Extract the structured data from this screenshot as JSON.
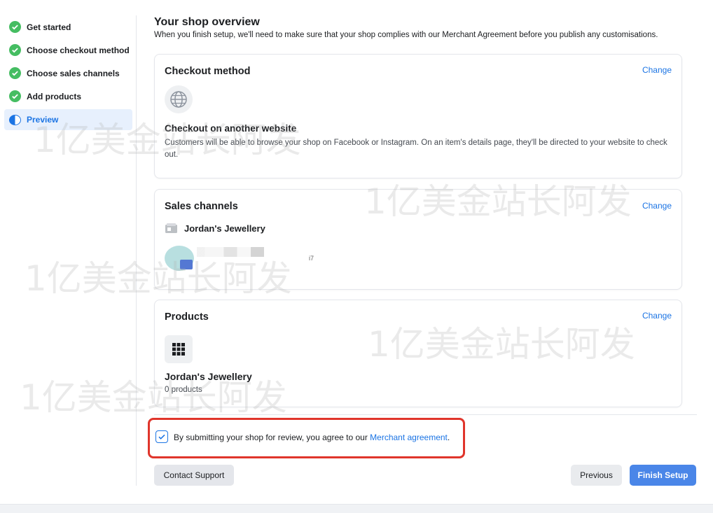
{
  "sidebar": {
    "steps": [
      {
        "label": "Get started",
        "state": "done"
      },
      {
        "label": "Choose checkout method",
        "state": "done"
      },
      {
        "label": "Choose sales channels",
        "state": "done"
      },
      {
        "label": "Add products",
        "state": "done"
      },
      {
        "label": "Preview",
        "state": "active"
      }
    ]
  },
  "header": {
    "title": "Your shop overview",
    "subtitle": "When you finish setup, we'll need to make sure that your shop complies with our Merchant Agreement before you publish any customisations."
  },
  "checkout": {
    "heading": "Checkout method",
    "change": "Change",
    "icon": "globe-icon",
    "method": "Checkout on another website",
    "description": "Customers will be able to browse your shop on Facebook or Instagram. On an item's details page, they'll be directed to your website to check out."
  },
  "sales": {
    "heading": "Sales channels",
    "change": "Change",
    "channel_name": "Jordan's Jewellery",
    "blurred_suffix": "i7"
  },
  "products": {
    "heading": "Products",
    "change": "Change",
    "catalog_name": "Jordan's Jewellery",
    "count": "0 products"
  },
  "agreement": {
    "checked": true,
    "text": "By submitting your shop for review, you agree to our ",
    "link": "Merchant agreement",
    "suffix": "."
  },
  "buttons": {
    "support": "Contact Support",
    "previous": "Previous",
    "finish": "Finish Setup"
  },
  "watermark": "1亿美金站长阿发",
  "colors": {
    "accent": "#1b74e4",
    "success": "#45bd62",
    "highlight_border": "#e0352b",
    "finish_button": "#4a86e8"
  }
}
